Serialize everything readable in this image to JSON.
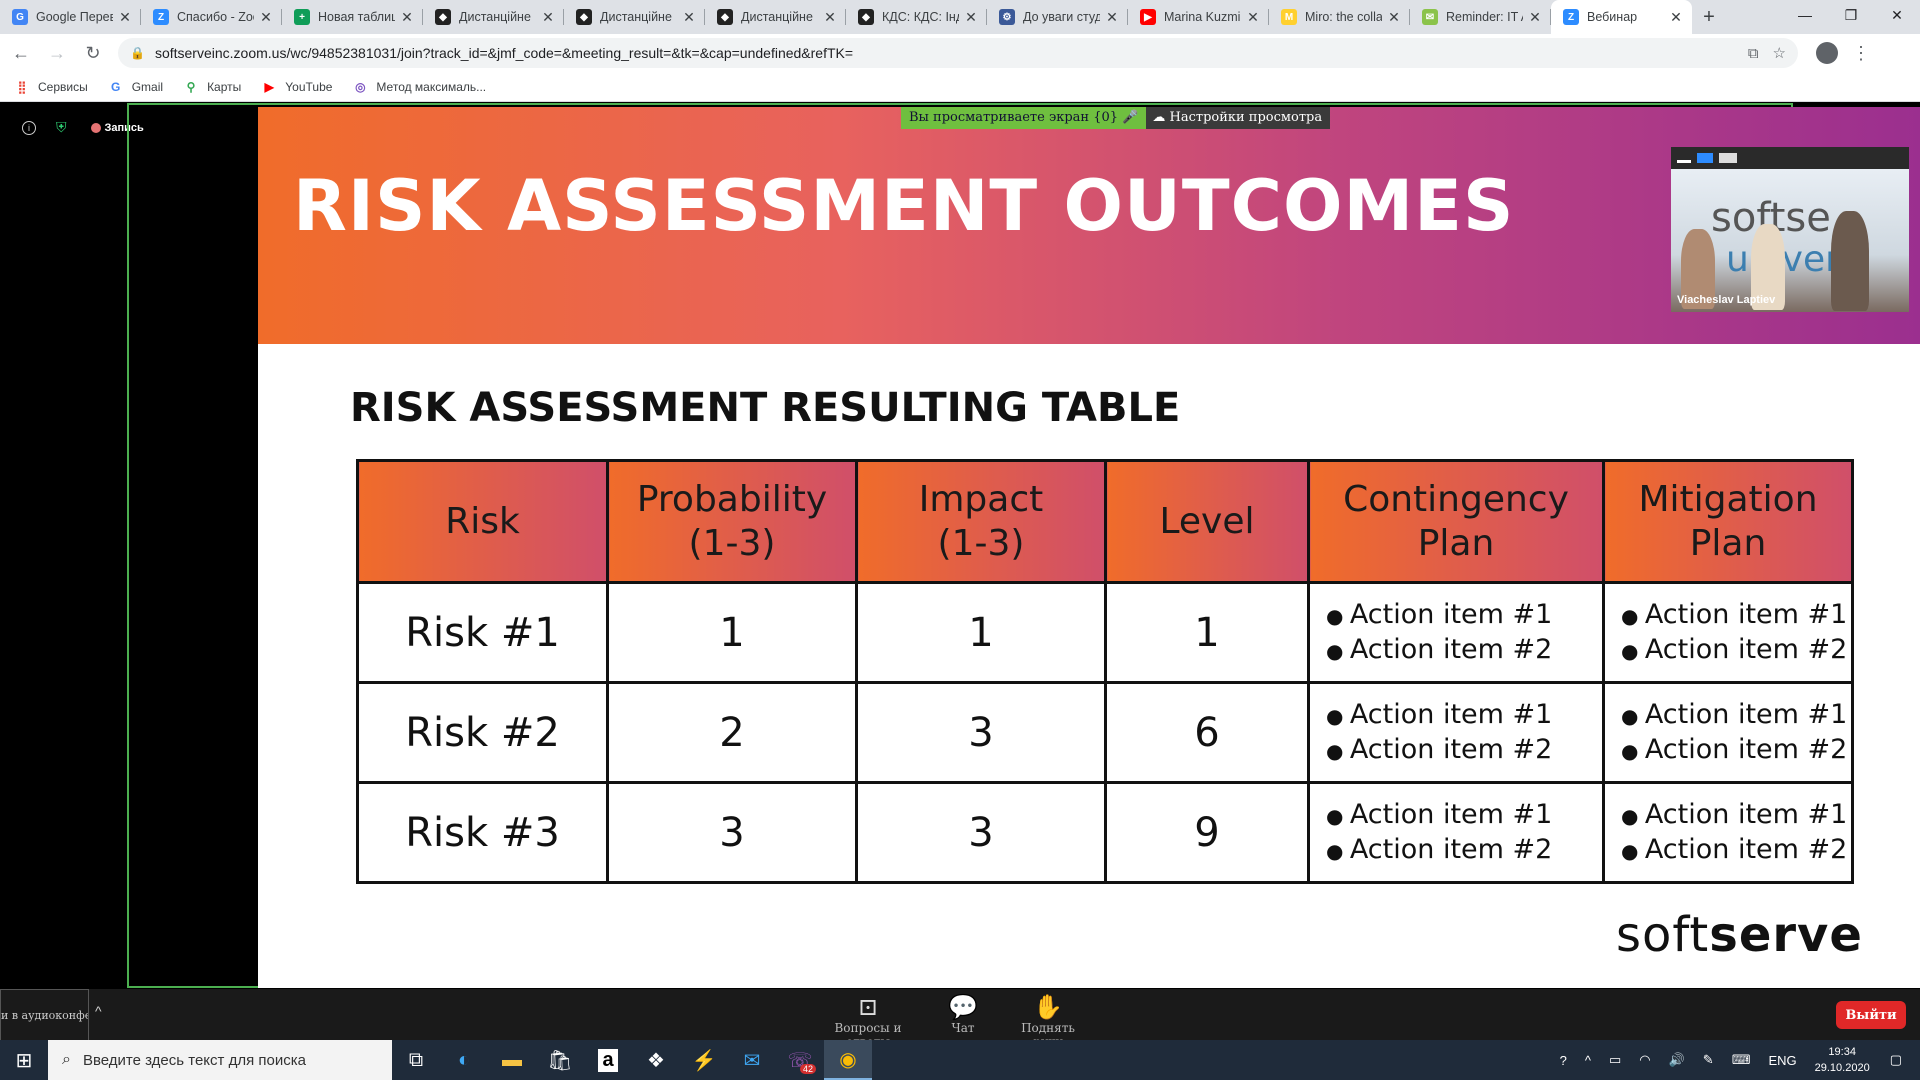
{
  "browser": {
    "tabs": [
      {
        "title": "Google Перев",
        "color": "#4285f4",
        "glyph": "G"
      },
      {
        "title": "Спасибо - Zoo",
        "color": "#2d8cff",
        "glyph": "Z"
      },
      {
        "title": "Новая таблиц",
        "color": "#0f9d58",
        "glyph": "+"
      },
      {
        "title": "Дистанційне",
        "color": "#222222",
        "glyph": "◆"
      },
      {
        "title": "Дистанційне",
        "color": "#222222",
        "glyph": "◆"
      },
      {
        "title": "Дистанційне",
        "color": "#222222",
        "glyph": "◆"
      },
      {
        "title": "КДС: КДС: Інд",
        "color": "#222222",
        "glyph": "◆"
      },
      {
        "title": "До уваги студ",
        "color": "#3b5998",
        "glyph": "⚙"
      },
      {
        "title": "Marina Kuzmi",
        "color": "#ff0000",
        "glyph": "▶"
      },
      {
        "title": "Miro: the colla",
        "color": "#ffd02f",
        "glyph": "M"
      },
      {
        "title": "Reminder: IT A",
        "color": "#8bc34a",
        "glyph": "✉"
      },
      {
        "title": "Вебинар",
        "color": "#2d8cff",
        "glyph": "Z"
      }
    ],
    "url": "softserveinc.zoom.us/wc/94852381031/join?track_id=&jmf_code=&meeting_result=&tk=&cap=undefined&refTK=",
    "bookmarks": [
      {
        "label": "Сервисы",
        "icon": "apps-grid-icon",
        "color": "#ea4335"
      },
      {
        "label": "Gmail",
        "icon": "google-icon",
        "color": "#4285f4"
      },
      {
        "label": "Карты",
        "icon": "maps-pin-icon",
        "color": "#34a853"
      },
      {
        "label": "YouTube",
        "icon": "youtube-icon",
        "color": "#ff0000"
      },
      {
        "label": "Метод максималь...",
        "icon": "circle-icon",
        "color": "#7e57c2"
      }
    ]
  },
  "zoom": {
    "record_label": "Запись",
    "viewing_label": "Вы просматриваете экран {0}",
    "view_settings_label": "Настройки просмотра",
    "speaker_name": "Viacheslav Laptiev",
    "speaker_bg_text_1": "softse",
    "speaker_bg_text_2": "univers",
    "audio_label": "и в аудиоконфере",
    "toolbar": {
      "qa_label": "Вопросы и ответы",
      "chat_label": "Чат",
      "raise_hand_label": "Поднять руку",
      "exit_label": "Выйти"
    }
  },
  "slide": {
    "title": "RISK ASSESSMENT OUTCOMES",
    "subtitle": "RISK ASSESSMENT RESULTING TABLE",
    "headers": [
      "Risk",
      "Probability\n(1-3)",
      "Impact\n(1-3)",
      "Level",
      "Contingency\nPlan",
      "Mitigation\nPlan"
    ],
    "rows": [
      {
        "risk": "Risk #1",
        "probability": "1",
        "impact": "1",
        "level": "1",
        "contingency": [
          "Action item #1",
          "Action item #2"
        ],
        "mitigation": [
          "Action item #1",
          "Action item #2"
        ]
      },
      {
        "risk": "Risk #2",
        "probability": "2",
        "impact": "3",
        "level": "6",
        "contingency": [
          "Action item #1",
          "Action item #2"
        ],
        "mitigation": [
          "Action item #1",
          "Action item #2"
        ]
      },
      {
        "risk": "Risk #3",
        "probability": "3",
        "impact": "3",
        "level": "9",
        "contingency": [
          "Action item #1",
          "Action item #2"
        ],
        "mitigation": [
          "Action item #1",
          "Action item #2"
        ]
      }
    ],
    "logo_light": "soft",
    "logo_bold": "serve"
  },
  "taskbar": {
    "search_placeholder": "Введите здесь текст для поиска",
    "viber_badge": "42",
    "language": "ENG",
    "time": "19:34",
    "date": "29.10.2020"
  }
}
